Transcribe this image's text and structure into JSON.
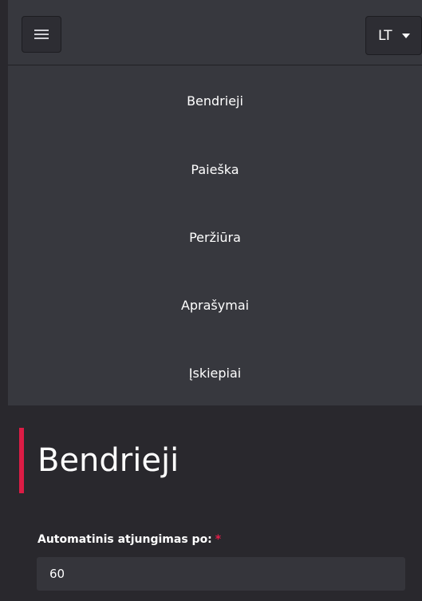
{
  "header": {
    "menu_icon": "hamburger-icon",
    "language": {
      "label": "LT",
      "icon": "caret-down-icon"
    }
  },
  "nav": {
    "items": [
      {
        "label": "Bendrieji"
      },
      {
        "label": "Paieška"
      },
      {
        "label": "Peržiūra"
      },
      {
        "label": "Aprašymai"
      },
      {
        "label": "Įskiepiai"
      }
    ]
  },
  "main": {
    "title": "Bendrieji",
    "field": {
      "label": "Automatinis atjungimas po:",
      "required_mark": "*",
      "value": "60"
    }
  },
  "colors": {
    "page_bg": "#29282d",
    "nav_bg": "#37383e",
    "accent": "#dc1c45",
    "input_bg": "#35353b"
  }
}
